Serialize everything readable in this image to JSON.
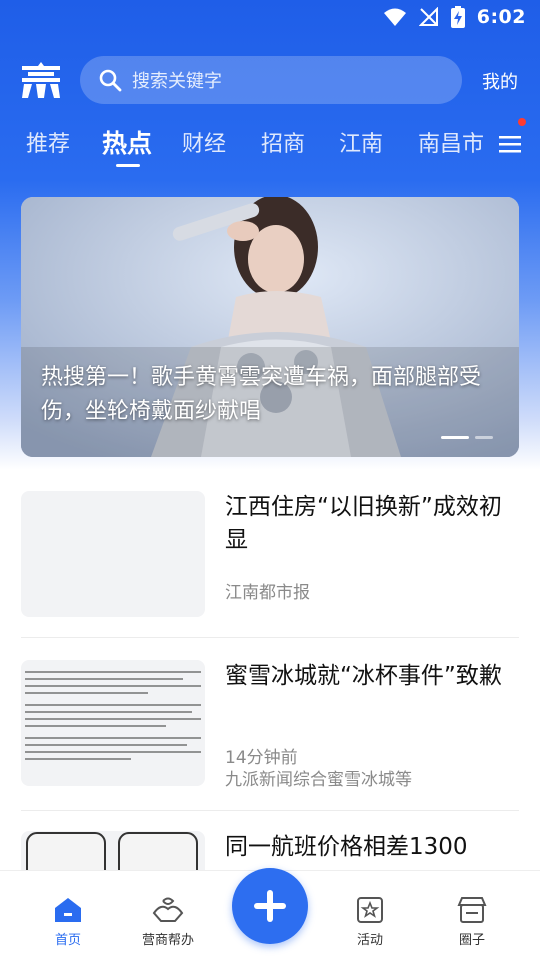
{
  "status_bar": {
    "time": "6:02"
  },
  "header": {
    "logo_name": "app-logo",
    "search_placeholder": "搜索关键字",
    "mine_label": "我的"
  },
  "tabs": [
    {
      "label": "推荐",
      "active": false
    },
    {
      "label": "热点",
      "active": true
    },
    {
      "label": "财经",
      "active": false
    },
    {
      "label": "招商",
      "active": false
    },
    {
      "label": "江南",
      "active": false
    },
    {
      "label": "南昌市",
      "active": false
    }
  ],
  "banner": {
    "caption": "热搜第一！歌手黄霄雲突遭车祸，面部腿部受伤，坐轮椅戴面纱献唱",
    "slide_count": 2,
    "active_slide": 1
  },
  "news": [
    {
      "title": "江西住房“以旧换新”成效初显",
      "source": "江南都市报",
      "time": ""
    },
    {
      "title": "蜜雪冰城就“冰杯事件”致歉",
      "source": "九派新闻综合蜜雪冰城等",
      "time": "14分钟前"
    },
    {
      "title": "同一航班价格相差1300",
      "source": "",
      "time": ""
    }
  ],
  "bottom_nav": [
    {
      "label": "首页",
      "icon": "home-icon",
      "active": true
    },
    {
      "label": "营商帮办",
      "icon": "handshake-icon",
      "active": false
    },
    {
      "label": "",
      "icon": "plus-icon",
      "active": false
    },
    {
      "label": "活动",
      "icon": "star-badge-icon",
      "active": false
    },
    {
      "label": "圈子",
      "icon": "store-icon",
      "active": false
    }
  ],
  "colors": {
    "brand": "#2a6cf0",
    "notification_dot": "#ff3b30"
  }
}
